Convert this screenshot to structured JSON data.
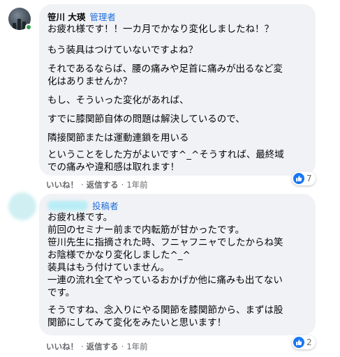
{
  "comments": [
    {
      "author": "笹川 大瑛",
      "role": "管理者",
      "lines": [
        "お疲れ様です！！一カ月でかなり変化しましたね！？",
        "もう装具はつけていないですよね？",
        "それであるならば、腰の痛みや足首に痛みが出るなど変",
        "化はありませんか？",
        "もし、そういった変化があれば、",
        "すでに膝関節自体の問題は解決しているので、",
        "隣接関節または運動連鎖を用いる",
        "ということをした方がよいです^_^そうすれば、最終域",
        "での痛みや違和感は取れます！"
      ],
      "like": "いいね！",
      "reply": "返信する",
      "time": "1年前",
      "reaction_count": "7"
    },
    {
      "author": "",
      "role": "投稿者",
      "lines": [
        "お疲れ様です。",
        "前回のセミナー前まで内転筋が甘かったです。",
        "笹川先生に指摘された時、フニャフニャでしたからね笑",
        "お陰様でかなり変化しました^_^",
        "装具はもう付けていません。",
        "一連の流れ全てやっているおかげか他に痛みも出てない",
        "です。",
        "そうですね、念入りにやる関節を膝関節から、まずは股",
        "関節にしてみて変化をみたいと思います！"
      ],
      "like": "いいね！",
      "reply": "返信する",
      "time": "1年前",
      "reaction_count": "2"
    }
  ],
  "colors": {
    "bubble": "#f0f2f5",
    "role_badge": "#216fdb",
    "like_blue": "#1877f2",
    "online": "#31a24c"
  }
}
